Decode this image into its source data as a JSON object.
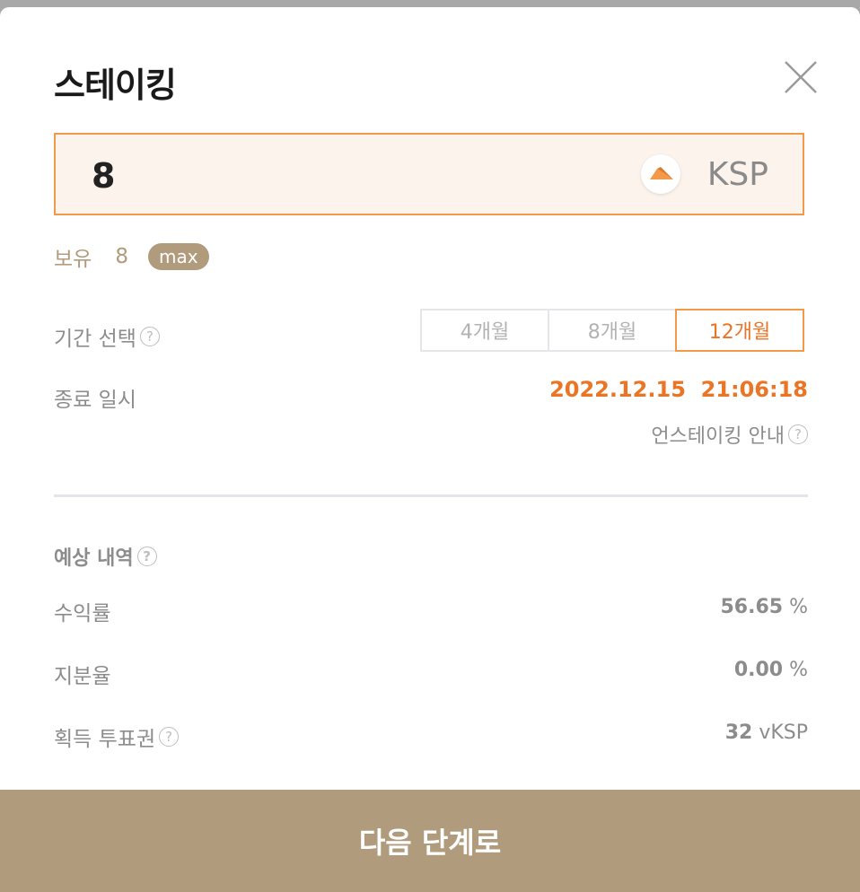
{
  "modal": {
    "title": "스테이킹",
    "close_icon": "close-icon"
  },
  "amount": {
    "value": "8",
    "token": "KSP",
    "token_icon": "ksp-logo-icon"
  },
  "holding": {
    "label": "보유",
    "value": "8",
    "max_label": "max"
  },
  "period": {
    "label": "기간 선택",
    "options": [
      "4개월",
      "8개월",
      "12개월"
    ],
    "selected": "12개월"
  },
  "end": {
    "label": "종료 일시",
    "datetime": "2022.12.15  21:06:18",
    "unstake_link": "언스테이킹 안내"
  },
  "estimate": {
    "title": "예상 내역",
    "rows": [
      {
        "label": "수익률",
        "value": "56.65",
        "unit": "%"
      },
      {
        "label": "지분율",
        "value": "0.00",
        "unit": "%"
      },
      {
        "label": "획득 투표권",
        "value": "32",
        "unit": "vKSP"
      }
    ]
  },
  "next_button": "다음 단계로",
  "colors": {
    "accent": "#eb7425",
    "brand": "#b19b7d",
    "input_bg": "#fbf3ec"
  }
}
